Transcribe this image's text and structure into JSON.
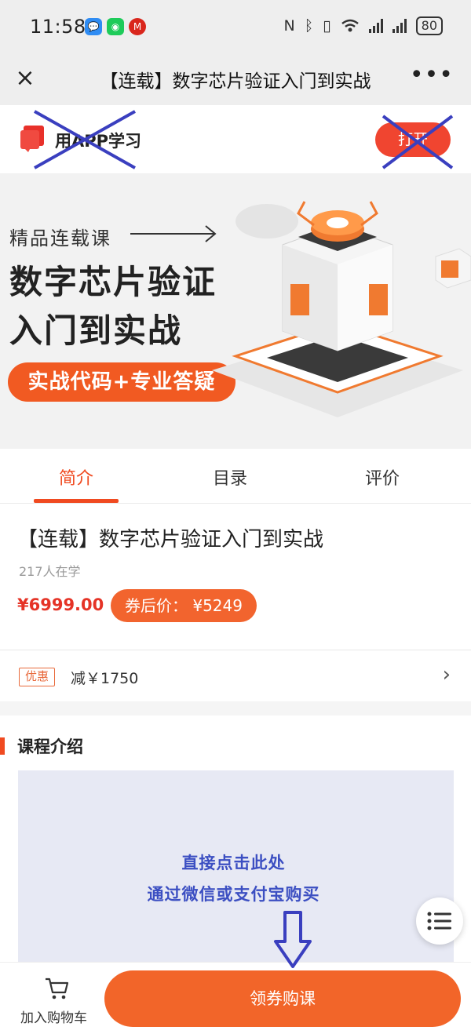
{
  "status_bar": {
    "time": "11:58",
    "battery": "80",
    "icons": [
      "nfc-icon",
      "bluetooth-icon",
      "vibrate-icon",
      "wifi-icon",
      "signal-icon",
      "signal-icon"
    ]
  },
  "nav": {
    "close_icon": "×",
    "title": "【连载】数字芯片验证入门到实战",
    "more_icon": "•••"
  },
  "app_banner": {
    "text": "用APP学习",
    "open_button": "打开"
  },
  "course_banner": {
    "tag": "精品连载课",
    "title_line1": "数字芯片验证",
    "title_line2": "入门到实战",
    "pill": "实战代码+专业答疑"
  },
  "tabs": [
    {
      "label": "简介",
      "active": true
    },
    {
      "label": "目录",
      "active": false
    },
    {
      "label": "评价",
      "active": false
    }
  ],
  "course": {
    "title": "【连载】数字芯片验证入门到实战",
    "learners": "217人在学",
    "price": "¥6999.00",
    "coupon_price": "券后价：  ¥5249"
  },
  "discount": {
    "tag": "优惠",
    "text": "减￥1750",
    "chevron": "›"
  },
  "intro": {
    "heading": "课程介绍",
    "annotation_line1": "直接点击此处",
    "annotation_line2": "通过微信或支付宝购买"
  },
  "bottom_bar": {
    "cart_label": "加入购物车",
    "buy_label": "领券购课"
  },
  "colors": {
    "accent": "#f04a20",
    "button": "#f26529",
    "annotation_blue": "#3c4fc2"
  }
}
